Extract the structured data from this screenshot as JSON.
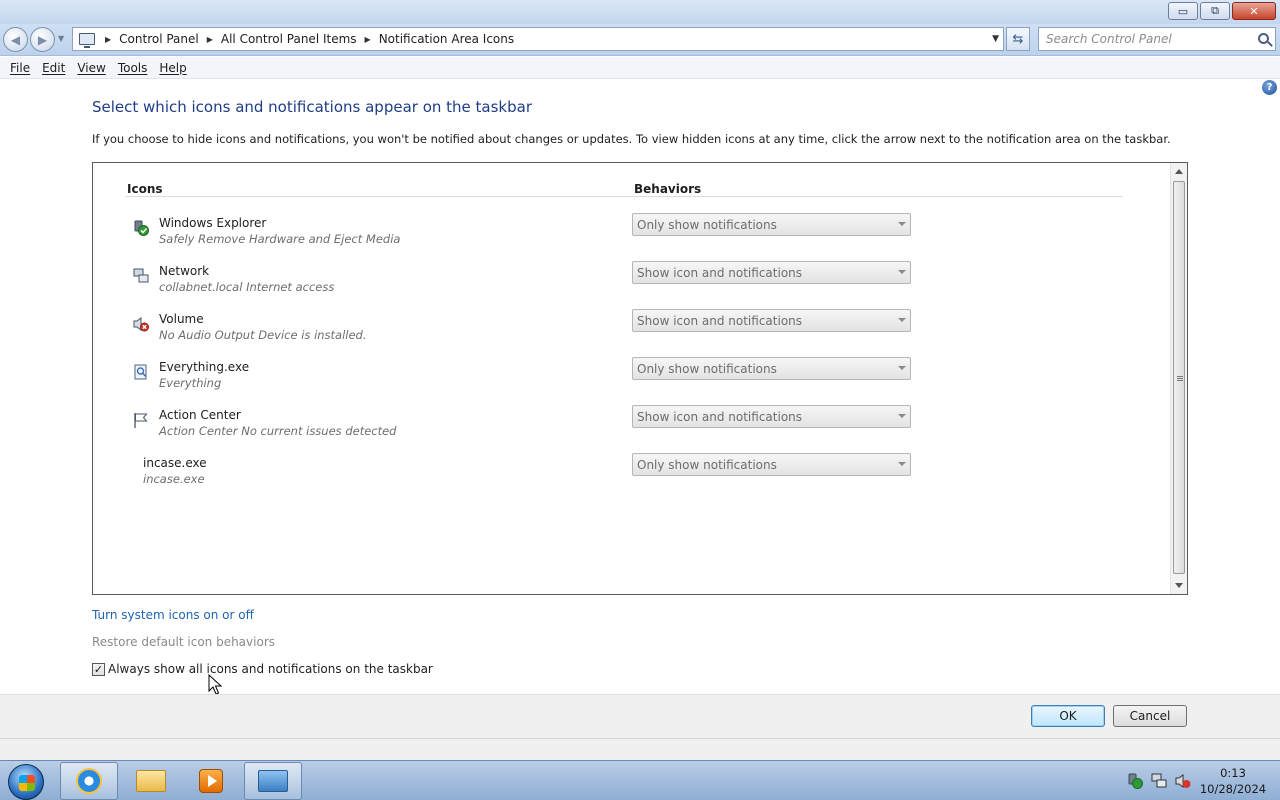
{
  "window": {
    "controls": {
      "minimize": "▭",
      "restore": "⧉",
      "close": "✕"
    }
  },
  "address_bar": {
    "breadcrumbs": [
      "Control Panel",
      "All Control Panel Items",
      "Notification Area Icons"
    ],
    "search_placeholder": "Search Control Panel"
  },
  "menu": {
    "items": [
      "File",
      "Edit",
      "View",
      "Tools",
      "Help"
    ]
  },
  "page": {
    "heading": "Select which icons and notifications appear on the taskbar",
    "description": "If you choose to hide icons and notifications, you won't be notified about changes or updates. To view hidden icons at any time, click the arrow next to the notification area on the taskbar.",
    "columns": {
      "icons": "Icons",
      "behaviors": "Behaviors"
    },
    "rows": [
      {
        "name": "Windows Explorer",
        "subtitle": "Safely Remove Hardware and Eject Media",
        "behavior": "Only show notifications",
        "icon": "usb-eject-icon"
      },
      {
        "name": "Network",
        "subtitle": "collabnet.local Internet access",
        "behavior": "Show icon and notifications",
        "icon": "network-icon"
      },
      {
        "name": "Volume",
        "subtitle": "No Audio Output Device is installed.",
        "behavior": "Show icon and notifications",
        "icon": "volume-muted-icon"
      },
      {
        "name": "Everything.exe",
        "subtitle": "Everything",
        "behavior": "Only show notifications",
        "icon": "everything-icon"
      },
      {
        "name": "Action Center",
        "subtitle": "Action Center  No current issues detected",
        "behavior": "Show icon and notifications",
        "icon": "flag-icon"
      },
      {
        "name": "incase.exe",
        "subtitle": "incase.exe",
        "behavior": "Only show notifications",
        "icon": ""
      }
    ],
    "links": {
      "system_icons": "Turn system icons on or off",
      "restore_defaults": "Restore default icon behaviors"
    },
    "always_show": {
      "label": "Always show all icons and notifications on the taskbar",
      "checked": true
    }
  },
  "buttons": {
    "ok": "OK",
    "cancel": "Cancel"
  },
  "taskbar": {
    "apps": [
      "internet-explorer-icon",
      "windows-explorer-icon",
      "media-player-icon",
      "control-panel-icon"
    ],
    "clock_time": "0:13",
    "clock_date": "10/28/2024"
  },
  "colors": {
    "heading": "#1f3d85",
    "link": "#1e64b0",
    "disabled_link": "#8a8a8a"
  }
}
